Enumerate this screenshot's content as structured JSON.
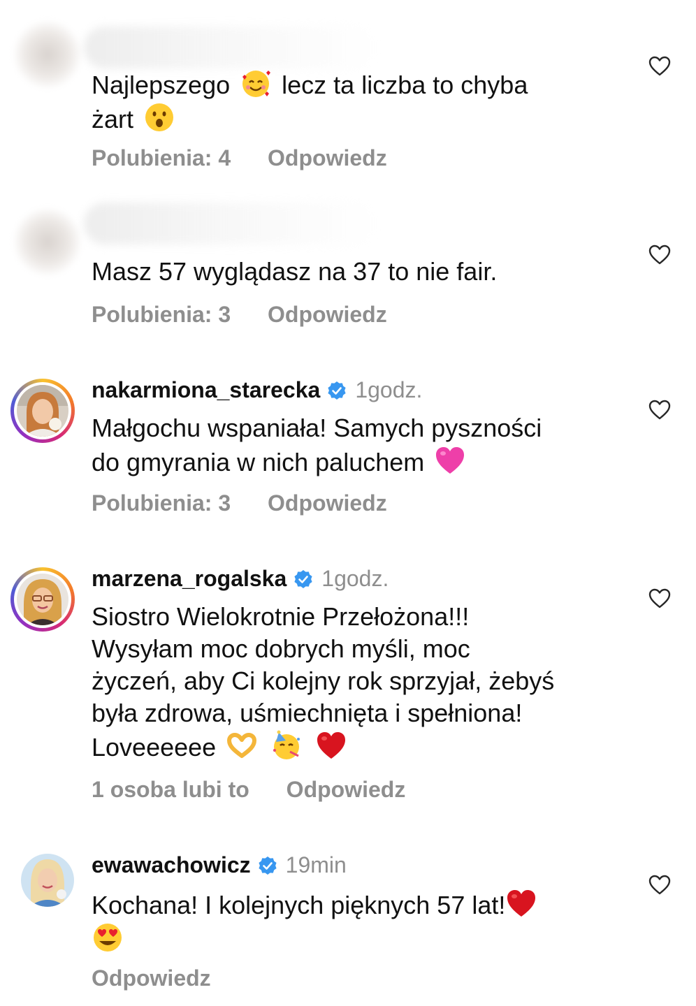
{
  "comments": [
    {
      "username": "",
      "time": "",
      "text": "Najlepszego 🥰 lecz ta liczba to chyba żart 😮",
      "text_parts": [
        "Najlepszego",
        "lecz ta liczba to chyba",
        "żart"
      ],
      "likes": "Polubienia: 4",
      "reply": "Odpowiedz"
    },
    {
      "username": "",
      "time": "",
      "text": "Masz 57 wyglądasz na 37 to nie fair.",
      "likes": "Polubienia: 3",
      "reply": "Odpowiedz"
    },
    {
      "username": "nakarmiona_starecka",
      "time": "1godz.",
      "text_line1": "Małgochu wspaniała! Samych pyszności",
      "text_line2": "do gmyrania w nich paluchem",
      "likes": "Polubienia: 3",
      "reply": "Odpowiedz"
    },
    {
      "username": "marzena_rogalska",
      "time": "1godz.",
      "text_line1": "Siostro Wielokrotnie Przełożona!!!",
      "text_line2": "Wysyłam moc dobrych myśli, moc",
      "text_line3": "życzeń, aby Ci kolejny rok sprzyjał, żebyś",
      "text_line4": "była zdrowa, uśmiechnięta i spełniona!",
      "text_line5": "Loveeeeee",
      "likes": "1 osoba lubi to",
      "reply": "Odpowiedz"
    },
    {
      "username": "ewawachowicz",
      "time": "19min",
      "text_line1": "Kochana! I kolejnych pięknych 57 lat!",
      "reply": "Odpowiedz"
    }
  ],
  "colors": {
    "text": "#111111",
    "secondary": "#8e8e8e",
    "verified": "#3897f0",
    "heart_outline": "#262626"
  },
  "icons": [
    "heart-outline-icon",
    "verified-badge-icon"
  ]
}
